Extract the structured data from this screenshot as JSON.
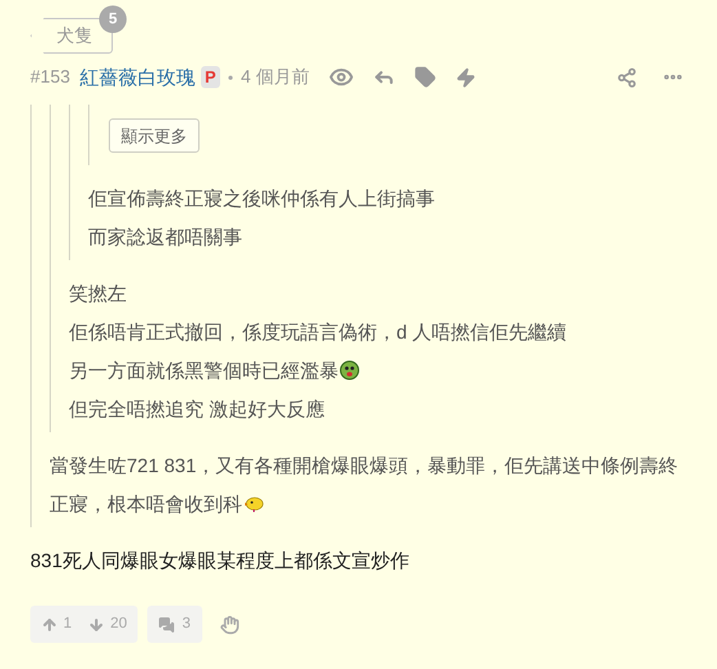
{
  "tag": {
    "label": "犬隻",
    "count": "5"
  },
  "post": {
    "number": "#153",
    "author": "紅薔薇白玫瑰",
    "badge": "P",
    "time": "4 個月前"
  },
  "quote": {
    "lines": [
      {
        "text": "當發生咗721 831，又有各種開槍爆眼爆頭，暴動罪，佢先講送中條例壽終正寢，根本唔會收到科",
        "kind": "chick-emoji"
      }
    ],
    "child": {
      "lines": [
        {
          "text": "笑撚左",
          "kind": "plain"
        },
        {
          "text": "佢係唔肯正式撤回，係度玩語言偽術，d 人唔撚信佢先繼續",
          "kind": "plain"
        },
        {
          "text": "另一方面就係黑警個時已經濫暴",
          "kind": "sick-emoji"
        },
        {
          "text": "但完全唔撚追究 激起好大反應",
          "kind": "plain"
        }
      ],
      "child": {
        "lines": [
          {
            "text": "佢宣佈壽終正寢之後咪仲係有人上街搞事",
            "kind": "plain"
          },
          {
            "text": "而家諗返都唔關事",
            "kind": "plain"
          }
        ],
        "child": {
          "show_more": "顯示更多"
        }
      }
    }
  },
  "body": "831死人同爆眼女爆眼某程度上都係文宣炒作",
  "footer": {
    "upvotes": "1",
    "downvotes": "20",
    "replies": "3"
  }
}
